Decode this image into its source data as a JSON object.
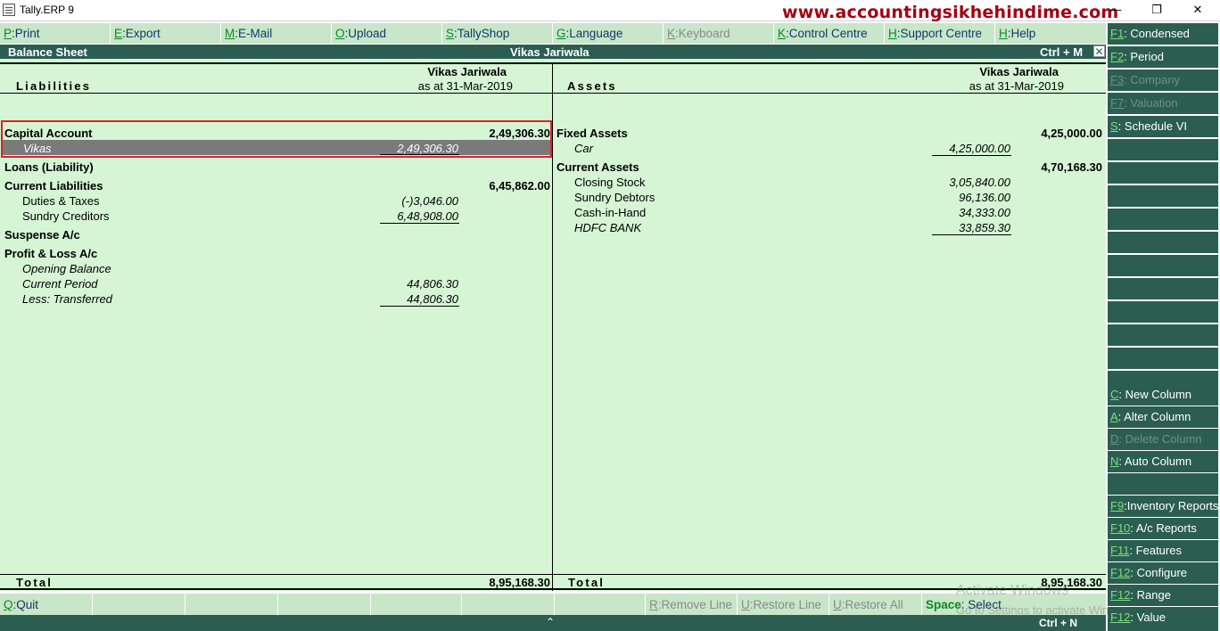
{
  "window": {
    "title": "Tally.ERP 9",
    "watermark": "www.accountingsikhehindime.com",
    "minimize_glyph": "—",
    "maximize_glyph": "❐",
    "close_glyph": "✕"
  },
  "menu": [
    {
      "key": "P",
      "label": "Print",
      "enabled": true
    },
    {
      "key": "E",
      "label": "Export",
      "enabled": true
    },
    {
      "key": "M",
      "label": "E-Mail",
      "enabled": true
    },
    {
      "key": "O",
      "label": "Upload",
      "enabled": true
    },
    {
      "key": "S",
      "label": "TallyShop",
      "enabled": true
    },
    {
      "key": "G",
      "label": "Language",
      "enabled": true
    },
    {
      "key": "K",
      "label": "Keyboard",
      "enabled": false
    },
    {
      "key": "K",
      "label": "Control Centre",
      "enabled": true
    },
    {
      "key": "H",
      "label": "Support Centre",
      "enabled": true
    },
    {
      "key": "H",
      "label": "Help",
      "enabled": true
    }
  ],
  "header": {
    "report_name": "Balance Sheet",
    "company": "Vikas Jariwala",
    "shortcut": "Ctrl + M",
    "close_glyph": "✕"
  },
  "liabilities": {
    "heading": "Liabilities",
    "company": "Vikas Jariwala",
    "date": "as at 31-Mar-2019",
    "groups": {
      "capital": {
        "name": "Capital Account",
        "total": "2,49,306.30",
        "items": [
          {
            "name": "Vikas",
            "amount": "2,49,306.30"
          }
        ]
      },
      "loans": {
        "name": "Loans (Liability)"
      },
      "current": {
        "name": "Current Liabilities",
        "total": "6,45,862.00",
        "items": [
          {
            "name": "Duties & Taxes",
            "amount": "(-)3,046.00"
          },
          {
            "name": "Sundry Creditors",
            "amount": "6,48,908.00"
          }
        ]
      },
      "suspense": {
        "name": "Suspense A/c"
      },
      "pl": {
        "name": "Profit & Loss A/c",
        "items": [
          {
            "name": "Opening Balance",
            "amount": ""
          },
          {
            "name": "Current Period",
            "amount": "44,806.30"
          },
          {
            "name": "Less: Transferred",
            "amount": "44,806.30"
          }
        ]
      }
    },
    "total_label": "Total",
    "total": "8,95,168.30"
  },
  "assets": {
    "heading": "Assets",
    "company": "Vikas Jariwala",
    "date": "as at 31-Mar-2019",
    "groups": {
      "fixed": {
        "name": "Fixed Assets",
        "total": "4,25,000.00",
        "items": [
          {
            "name": "Car",
            "amount": "4,25,000.00"
          }
        ]
      },
      "current": {
        "name": "Current Assets",
        "total": "4,70,168.30",
        "items": [
          {
            "name": "Closing Stock",
            "amount": "3,05,840.00"
          },
          {
            "name": "Sundry Debtors",
            "amount": "96,136.00"
          },
          {
            "name": "Cash-in-Hand",
            "amount": "34,333.00"
          },
          {
            "name": "HDFC BANK",
            "amount": "33,859.30"
          }
        ]
      }
    },
    "total_label": "Total",
    "total": "8,95,168.30"
  },
  "bottom": {
    "quit": {
      "key": "Q",
      "label": "Quit"
    },
    "remove_line": {
      "key": "R",
      "label": "Remove Line"
    },
    "restore_line": {
      "key": "U",
      "label": "Restore Line"
    },
    "restore_all": {
      "key": "U",
      "label": "Restore All"
    },
    "select": {
      "key": "Space",
      "label": "Select"
    }
  },
  "statusbar": {
    "chevron": "⌃",
    "shortcut": "Ctrl + N"
  },
  "activation": {
    "line1": "Activate Windows",
    "line2": "Go to Settings to activate Windows."
  },
  "sidebar": {
    "condensed": {
      "key": "F1",
      "label": "Condensed"
    },
    "period": {
      "key": "F2",
      "label": "Period"
    },
    "company": {
      "key": "F3",
      "label": "Company"
    },
    "valuation": {
      "key": "F7",
      "label": "Valuation"
    },
    "schedule": {
      "key": "S",
      "label": "Schedule VI"
    },
    "new_column": {
      "key": "C",
      "label": "New Column"
    },
    "alter_column": {
      "key": "A",
      "label": "Alter Column"
    },
    "delete_column": {
      "key": "D",
      "label": "Delete Column"
    },
    "auto_column": {
      "key": "N",
      "label": "Auto Column"
    },
    "inventory": {
      "key": "F9",
      "label": "Inventory Reports"
    },
    "ac_reports": {
      "key": "F10",
      "label": "A/c Reports"
    },
    "features": {
      "key": "F11",
      "label": "Features"
    },
    "configure": {
      "key": "F12",
      "label": "Configure"
    },
    "range": {
      "key": "F12",
      "label": "Range"
    },
    "value": {
      "key": "F12",
      "label": "Value"
    }
  },
  "colors": {
    "report_bg": "#d5f5d5",
    "bar_bg": "#2b5e50",
    "menu_bg": "#c8e6c8",
    "hotkey": "#0a8a2a",
    "watermark": "#a50012",
    "highlight_border": "#e0202a"
  }
}
